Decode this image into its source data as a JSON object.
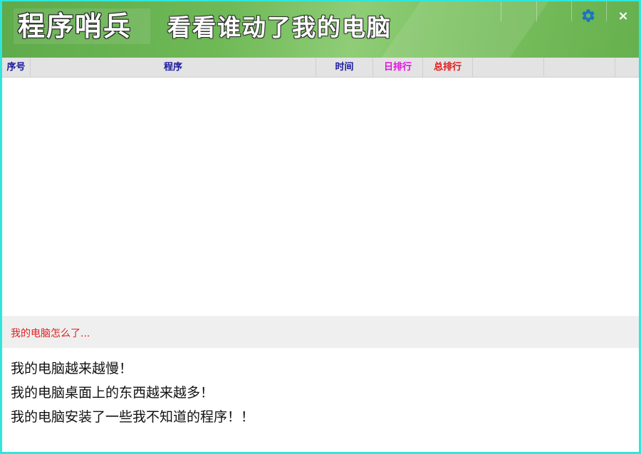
{
  "app": {
    "title": "程序哨兵",
    "slogan": "看看谁动了我的电脑"
  },
  "titlebar": {
    "settings_icon": "gear-icon",
    "close_icon": "close-icon",
    "close_glyph": "×"
  },
  "table": {
    "columns": [
      {
        "label": "序号",
        "color": "#1a1a9e"
      },
      {
        "label": "程序",
        "color": "#1a1a9e"
      },
      {
        "label": "时间",
        "color": "#1a1a9e"
      },
      {
        "label": "日排行",
        "color": "#e012e0"
      },
      {
        "label": "总排行",
        "color": "#e01818"
      },
      {
        "label": "",
        "color": "#1a1a9e"
      },
      {
        "label": "",
        "color": "#1a1a9e"
      },
      {
        "label": "",
        "color": "#1a1a9e"
      }
    ],
    "rows": []
  },
  "notice": {
    "heading": "我的电脑怎么了...",
    "lines": [
      "我的电脑越来越慢！",
      "我的电脑桌面上的东西越来越多！",
      "我的电脑安装了一些我不知道的程序！！"
    ]
  },
  "colors": {
    "border": "#2ee6dc",
    "titlebar_green": "#6fb957",
    "gear": "#1a73c8",
    "notice_heading": "#e02020"
  }
}
